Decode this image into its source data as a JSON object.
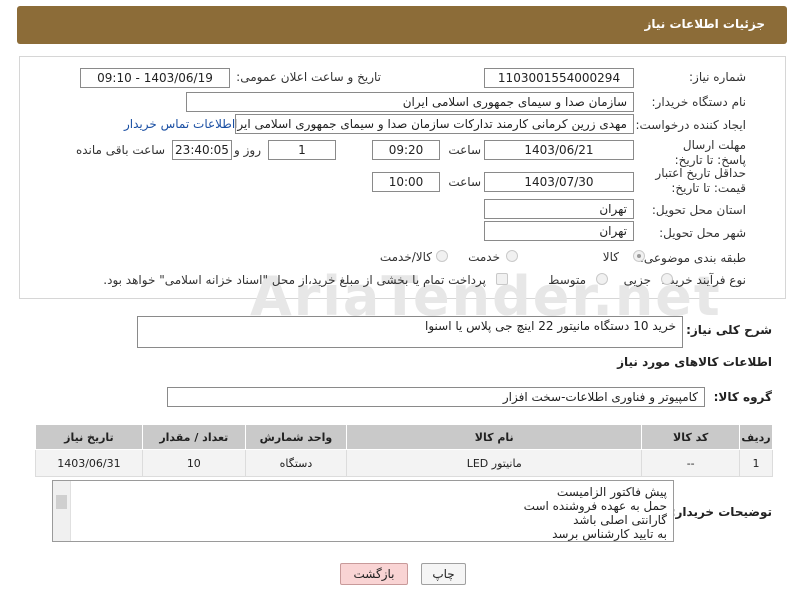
{
  "header": {
    "title": "جزئیات اطلاعات نیاز"
  },
  "form": {
    "need_number_label": "شماره نیاز:",
    "need_number": "1103001554000294",
    "announce_label": "تاریخ و ساعت اعلان عمومی:",
    "announce_value": "1403/06/19 - 09:10",
    "buyer_label": "نام دستگاه خریدار:",
    "buyer_value": "سازمان صدا و سیمای جمهوری اسلامی ایران",
    "creator_label": "ایجاد کننده درخواست:",
    "creator_value": "مهدی زرین کرمانی کارمند تدارکات سازمان صدا و سیمای جمهوری اسلامی ایران",
    "contact_link": "اطلاعات تماس خریدار",
    "reply_deadline_label": "مهلت ارسال پاسخ: تا تاریخ:",
    "reply_date": "1403/06/21",
    "time_label": "ساعت",
    "reply_time": "09:20",
    "days_value": "1",
    "days_label": "روز و",
    "remaining_value": "23:40:05",
    "remaining_label": "ساعت باقی مانده",
    "price_validity_label": "حداقل تاریخ اعتبار قیمت: تا تاریخ:",
    "price_date": "1403/07/30",
    "price_time_label": "ساعت",
    "price_time": "10:00",
    "province_label": "استان محل تحویل:",
    "province_value": "تهران",
    "city_label": "شهر محل تحویل:",
    "city_value": "تهران",
    "category_label": "طبقه بندی موضوعی:",
    "category_options": [
      "کالا",
      "خدمت",
      "کالا/خدمت"
    ],
    "category_selected": "کالا",
    "process_label": "نوع فرآیند خرید :",
    "process_options": [
      "جزیی",
      "متوسط"
    ],
    "payment_note": "پرداخت تمام یا بخشی از مبلغ خرید،از محل \"اسناد خزانه اسلامی\" خواهد بود."
  },
  "description": {
    "label": "شرح کلی نیاز:",
    "value": "خرید 10 دستگاه مانیتور 22 اینچ جی پلاس یا اسنوا"
  },
  "goods_info_title": "اطلاعات کالاهای مورد نیاز",
  "goods_group": {
    "label": "گروه کالا:",
    "value": "کامپیوتر و فناوری اطلاعات-سخت افزار"
  },
  "table": {
    "headers": [
      "ردیف",
      "کد کالا",
      "نام کالا",
      "واحد شمارش",
      "تعداد / مقدار",
      "تاریخ نیاز"
    ],
    "rows": [
      [
        "1",
        "--",
        "مانیتور LED",
        "دستگاه",
        "10",
        "1403/06/31"
      ]
    ]
  },
  "buyer_notes": {
    "label": "توضیحات خریدار:",
    "lines": [
      "پیش فاکتور الزامیست",
      "حمل به عهده فروشنده است",
      "گارانتی اصلی باشد",
      "به تایید کارشناس برسد"
    ]
  },
  "buttons": {
    "print": "چاپ",
    "back": "بازگشت"
  },
  "watermark": "AriaTender.net"
}
